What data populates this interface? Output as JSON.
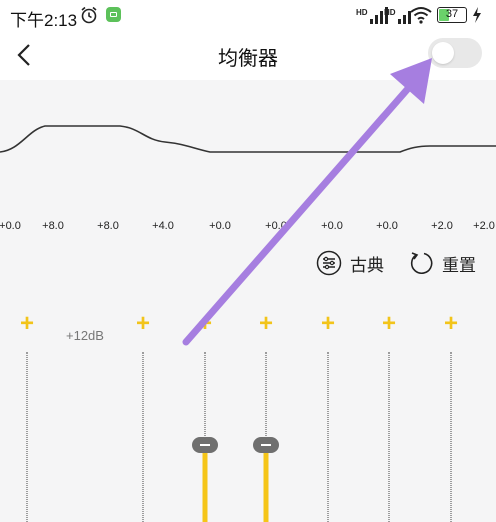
{
  "status_bar": {
    "time": "下午2:13",
    "battery": "37",
    "signal1_label": "HD",
    "signal2_label": "HD"
  },
  "header": {
    "title": "均衡器",
    "toggle_on": false
  },
  "equalizer": {
    "band_values": [
      "+0.0",
      "+8.0",
      "+8.0",
      "+4.0",
      "+0.0",
      "+0.0",
      "+0.0",
      "+0.0",
      "+2.0",
      "+2.0"
    ],
    "preset_label": "古典",
    "reset_label": "重置",
    "max_db_label": "+12dB",
    "slider_levels_db": [
      0,
      0
    ]
  },
  "colors": {
    "accent": "#f2c41a",
    "annotation_arrow": "#a67ee0"
  }
}
